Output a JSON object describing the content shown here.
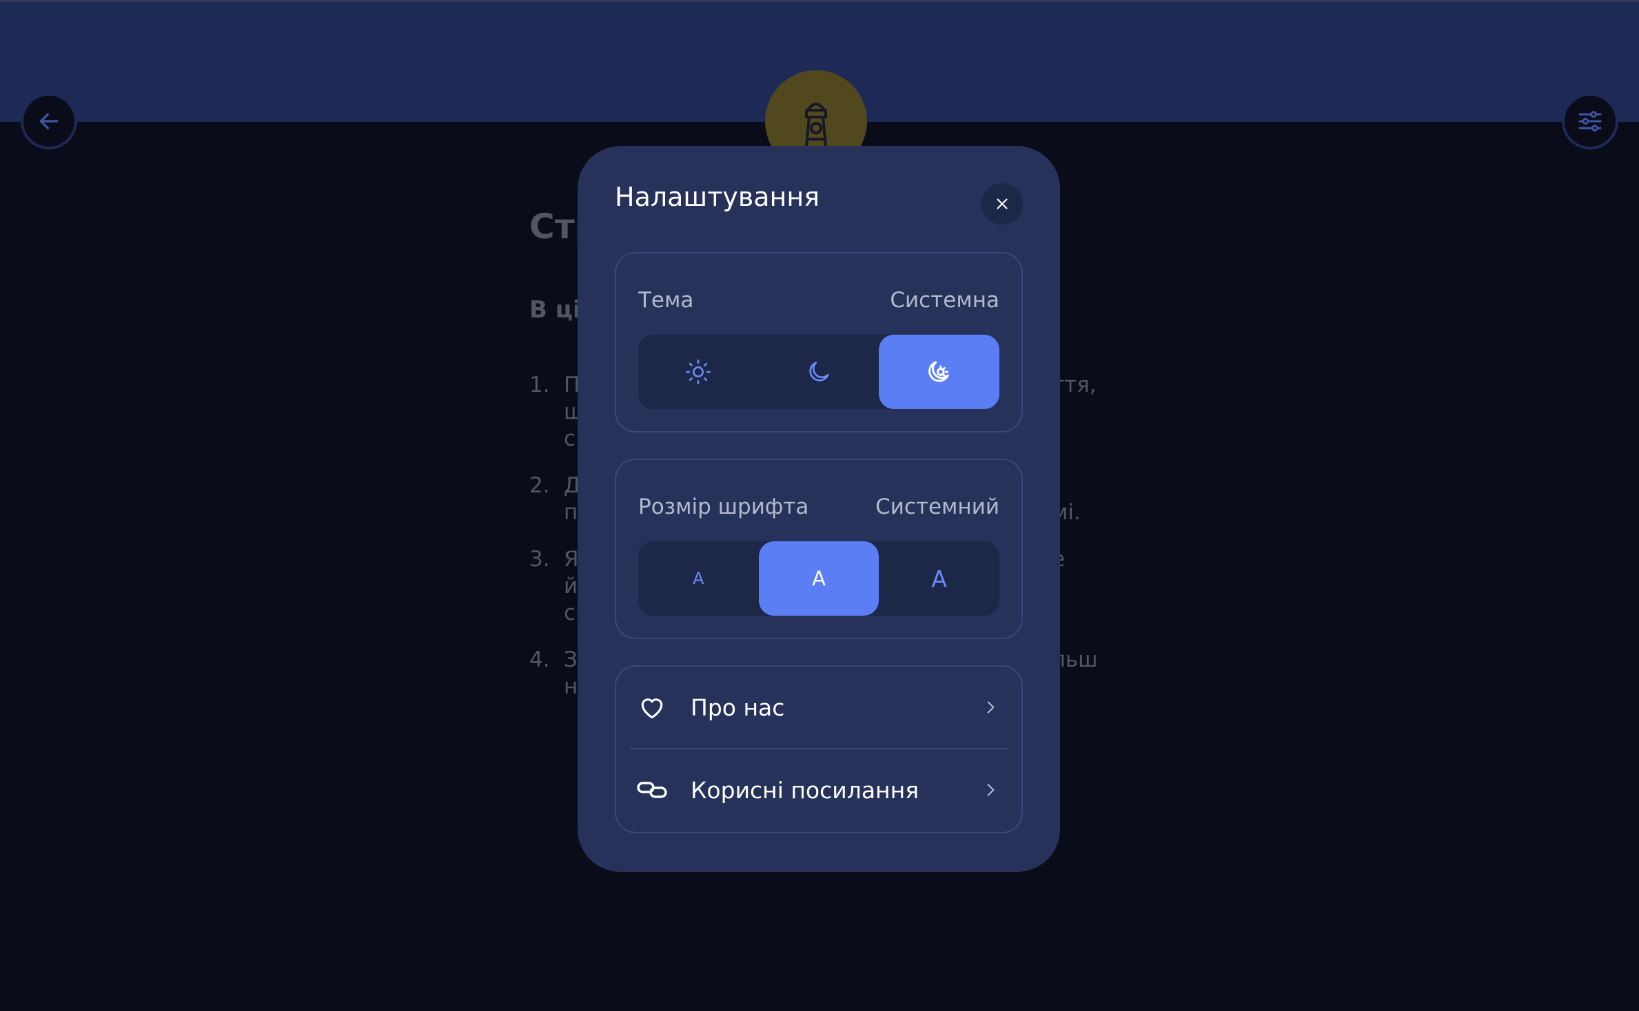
{
  "header": {
    "back_icon": "arrow-left-icon",
    "logo_icon": "lighthouse-icon",
    "settings_icon": "sliders-icon"
  },
  "background": {
    "title": "Стр",
    "subtitle": "В ці",
    "items": [
      {
        "num": "1.",
        "lines": [
          "П",
          "щ",
          "сі"
        ],
        "tail": "ття,"
      },
      {
        "num": "2.",
        "lines": [
          "Д",
          "п"
        ],
        "tail": "мі."
      },
      {
        "num": "3.",
        "lines": [
          "Я",
          "й",
          "сі"
        ],
        "tail": "е"
      },
      {
        "num": "4.",
        "lines": [
          "З",
          "н"
        ],
        "tail": "льш"
      }
    ]
  },
  "modal": {
    "title": "Налаштування",
    "close_icon": "close-icon",
    "theme": {
      "label": "Тема",
      "value": "Системна",
      "options": [
        "sun-icon",
        "moon-icon",
        "system-theme-icon"
      ],
      "selected_index": 2
    },
    "font_size": {
      "label": "Розмір шрифта",
      "value": "Системний",
      "options": [
        "A",
        "A",
        "A"
      ],
      "selected_index": 1
    },
    "links": [
      {
        "label": "Про нас",
        "icon": "heart-icon"
      },
      {
        "label": "Корисні посилання",
        "icon": "link-icon"
      }
    ]
  },
  "colors": {
    "header": "#283c7a",
    "background": "#0b0f1c",
    "modal": "#26325a",
    "accent": "#5b7ef5",
    "logo": "#7a6a24"
  }
}
